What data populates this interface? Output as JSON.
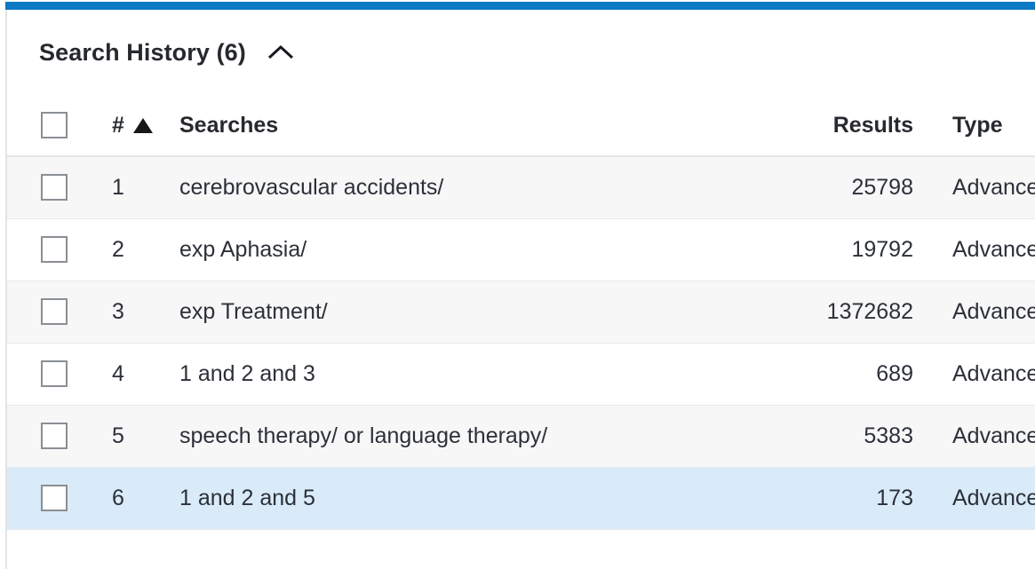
{
  "theme": {
    "accent_bar_color": "#0b79c4",
    "selected_row_color": "#d9ebf9",
    "alt_row_color": "#f7f7f8",
    "text_color": "#2c3038"
  },
  "panel": {
    "title": "Search History (6)",
    "collapse_icon": "chevron-up-icon"
  },
  "table": {
    "columns": {
      "select_all": "",
      "number": "#",
      "sort_indicator": "sort-ascending-icon",
      "searches": "Searches",
      "results": "Results",
      "type": "Type"
    },
    "rows": [
      {
        "number": "1",
        "query": "cerebrovascular accidents/",
        "results": "25798",
        "type": "Advanced",
        "checked": false,
        "selected": false
      },
      {
        "number": "2",
        "query": "exp Aphasia/",
        "results": "19792",
        "type": "Advanced",
        "checked": false,
        "selected": false
      },
      {
        "number": "3",
        "query": "exp Treatment/",
        "results": "1372682",
        "type": "Advanced",
        "checked": false,
        "selected": false
      },
      {
        "number": "4",
        "query": "1 and 2 and 3",
        "results": "689",
        "type": "Advanced",
        "checked": false,
        "selected": false
      },
      {
        "number": "5",
        "query": "speech therapy/ or language therapy/",
        "results": "5383",
        "type": "Advanced",
        "checked": false,
        "selected": false
      },
      {
        "number": "6",
        "query": "1 and 2 and 5",
        "results": "173",
        "type": "Advanced",
        "checked": false,
        "selected": true
      }
    ]
  }
}
